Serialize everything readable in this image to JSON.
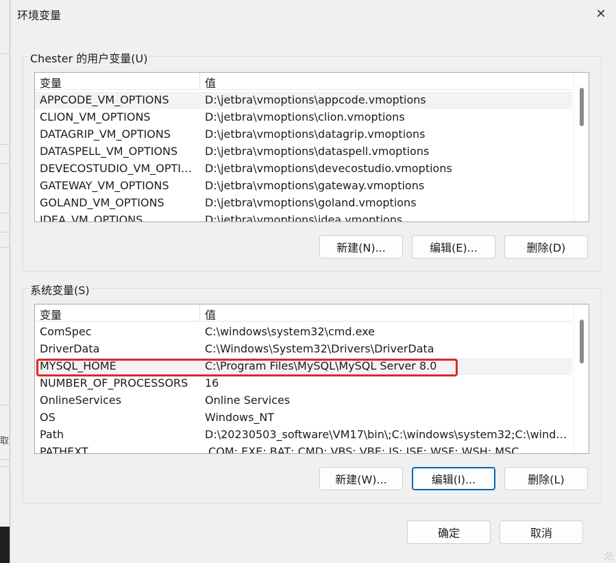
{
  "dialog": {
    "title": "环境变量",
    "close_glyph": "✕"
  },
  "background_text": "取消",
  "user_vars": {
    "group_label": "Chester 的用户变量(U)",
    "columns": {
      "name": "变量",
      "value": "值"
    },
    "rows": [
      {
        "name": "APPCODE_VM_OPTIONS",
        "value": "D:\\jetbra\\vmoptions\\appcode.vmoptions"
      },
      {
        "name": "CLION_VM_OPTIONS",
        "value": "D:\\jetbra\\vmoptions\\clion.vmoptions"
      },
      {
        "name": "DATAGRIP_VM_OPTIONS",
        "value": "D:\\jetbra\\vmoptions\\datagrip.vmoptions"
      },
      {
        "name": "DATASPELL_VM_OPTIONS",
        "value": "D:\\jetbra\\vmoptions\\dataspell.vmoptions"
      },
      {
        "name": "DEVECOSTUDIO_VM_OPTIO...",
        "value": "D:\\jetbra\\vmoptions\\devecostudio.vmoptions"
      },
      {
        "name": "GATEWAY_VM_OPTIONS",
        "value": "D:\\jetbra\\vmoptions\\gateway.vmoptions"
      },
      {
        "name": "GOLAND_VM_OPTIONS",
        "value": "D:\\jetbra\\vmoptions\\goland.vmoptions"
      },
      {
        "name": "IDEA_VM_OPTIONS",
        "value": "D:\\jetbra\\vmoptions\\idea.vmoptions"
      }
    ],
    "buttons": {
      "new": "新建(N)...",
      "edit": "编辑(E)...",
      "delete": "删除(D)"
    }
  },
  "system_vars": {
    "group_label": "系统变量(S)",
    "columns": {
      "name": "变量",
      "value": "值"
    },
    "rows": [
      {
        "name": "ComSpec",
        "value": "C:\\windows\\system32\\cmd.exe"
      },
      {
        "name": "DriverData",
        "value": "C:\\Windows\\System32\\Drivers\\DriverData"
      },
      {
        "name": "MYSQL_HOME",
        "value": "C:\\Program Files\\MySQL\\MySQL Server 8.0"
      },
      {
        "name": "NUMBER_OF_PROCESSORS",
        "value": "16"
      },
      {
        "name": "OnlineServices",
        "value": "Online Services"
      },
      {
        "name": "OS",
        "value": "Windows_NT"
      },
      {
        "name": "Path",
        "value": "D:\\20230503_software\\VM17\\bin\\;C:\\windows\\system32;C:\\window..."
      },
      {
        "name": "PATHEXT",
        "value": ".COM;.EXE;.BAT;.CMD;.VBS;.VBE;.JS;.JSE;.WSF;.WSH;.MSC"
      }
    ],
    "buttons": {
      "new": "新建(W)...",
      "edit": "编辑(I)...",
      "delete": "删除(L)"
    }
  },
  "footer": {
    "ok": "确定",
    "cancel": "取消"
  },
  "colors": {
    "highlight": "#e0262a",
    "focus": "#0063b1"
  }
}
